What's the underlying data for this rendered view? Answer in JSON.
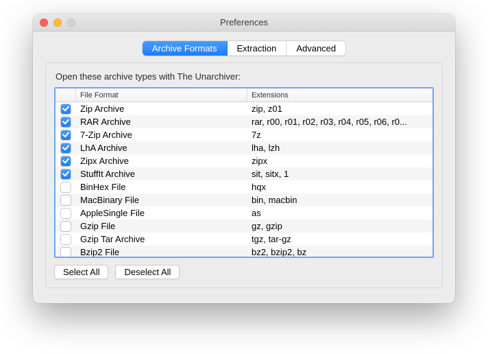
{
  "window": {
    "title": "Preferences"
  },
  "tabs": [
    {
      "label": "Archive Formats",
      "active": true
    },
    {
      "label": "Extraction",
      "active": false
    },
    {
      "label": "Advanced",
      "active": false
    }
  ],
  "instruction": "Open these archive types with The Unarchiver:",
  "columns": {
    "format": "File Format",
    "extensions": "Extensions"
  },
  "rows": [
    {
      "checked": true,
      "name": "Zip Archive",
      "ext": "zip, z01"
    },
    {
      "checked": true,
      "name": "RAR Archive",
      "ext": "rar, r00, r01, r02, r03, r04, r05, r06, r0..."
    },
    {
      "checked": true,
      "name": "7-Zip Archive",
      "ext": "7z"
    },
    {
      "checked": true,
      "name": "LhA Archive",
      "ext": "lha, lzh"
    },
    {
      "checked": true,
      "name": "Zipx Archive",
      "ext": "zipx"
    },
    {
      "checked": true,
      "name": "StuffIt Archive",
      "ext": "sit, sitx, 1"
    },
    {
      "checked": false,
      "name": "BinHex File",
      "ext": "hqx"
    },
    {
      "checked": false,
      "name": "MacBinary File",
      "ext": "bin, macbin"
    },
    {
      "checked": false,
      "name": "AppleSingle File",
      "ext": "as"
    },
    {
      "checked": false,
      "name": "Gzip File",
      "ext": "gz, gzip"
    },
    {
      "checked": false,
      "name": "Gzip Tar Archive",
      "ext": "tgz, tar-gz"
    },
    {
      "checked": false,
      "name": "Bzip2 File",
      "ext": "bz2, bzip2, bz"
    }
  ],
  "buttons": {
    "select_all": "Select All",
    "deselect_all": "Deselect All"
  }
}
